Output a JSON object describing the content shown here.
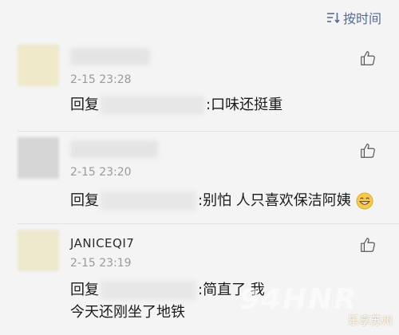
{
  "sort": {
    "label": "按时间",
    "icon": "sort-list-icon",
    "color": "#576b95"
  },
  "comments": [
    {
      "name": "",
      "name_blurred": true,
      "time": "2-15 23:28",
      "reply_prefix": "回复",
      "reply_text": ":口味还挺重",
      "avatar_color": "#efe8c9"
    },
    {
      "name": "",
      "name_blurred": true,
      "time": "2-15 23:20",
      "reply_prefix": "回复",
      "reply_text": ":别怕 人只喜欢保洁阿姨",
      "emoji": "grinning-face-emoji",
      "avatar_color": "#d6d6d6"
    },
    {
      "name": "JANICEQI7",
      "name_blurred": false,
      "time": "2-15 23:19",
      "reply_prefix": "回复",
      "reply_text": ":简直了 我今天还刚坐了地铁",
      "avatar_color": "#ede7cc"
    }
  ],
  "watermark": {
    "text": "乐享苏州",
    "ghost": "94HNR"
  }
}
